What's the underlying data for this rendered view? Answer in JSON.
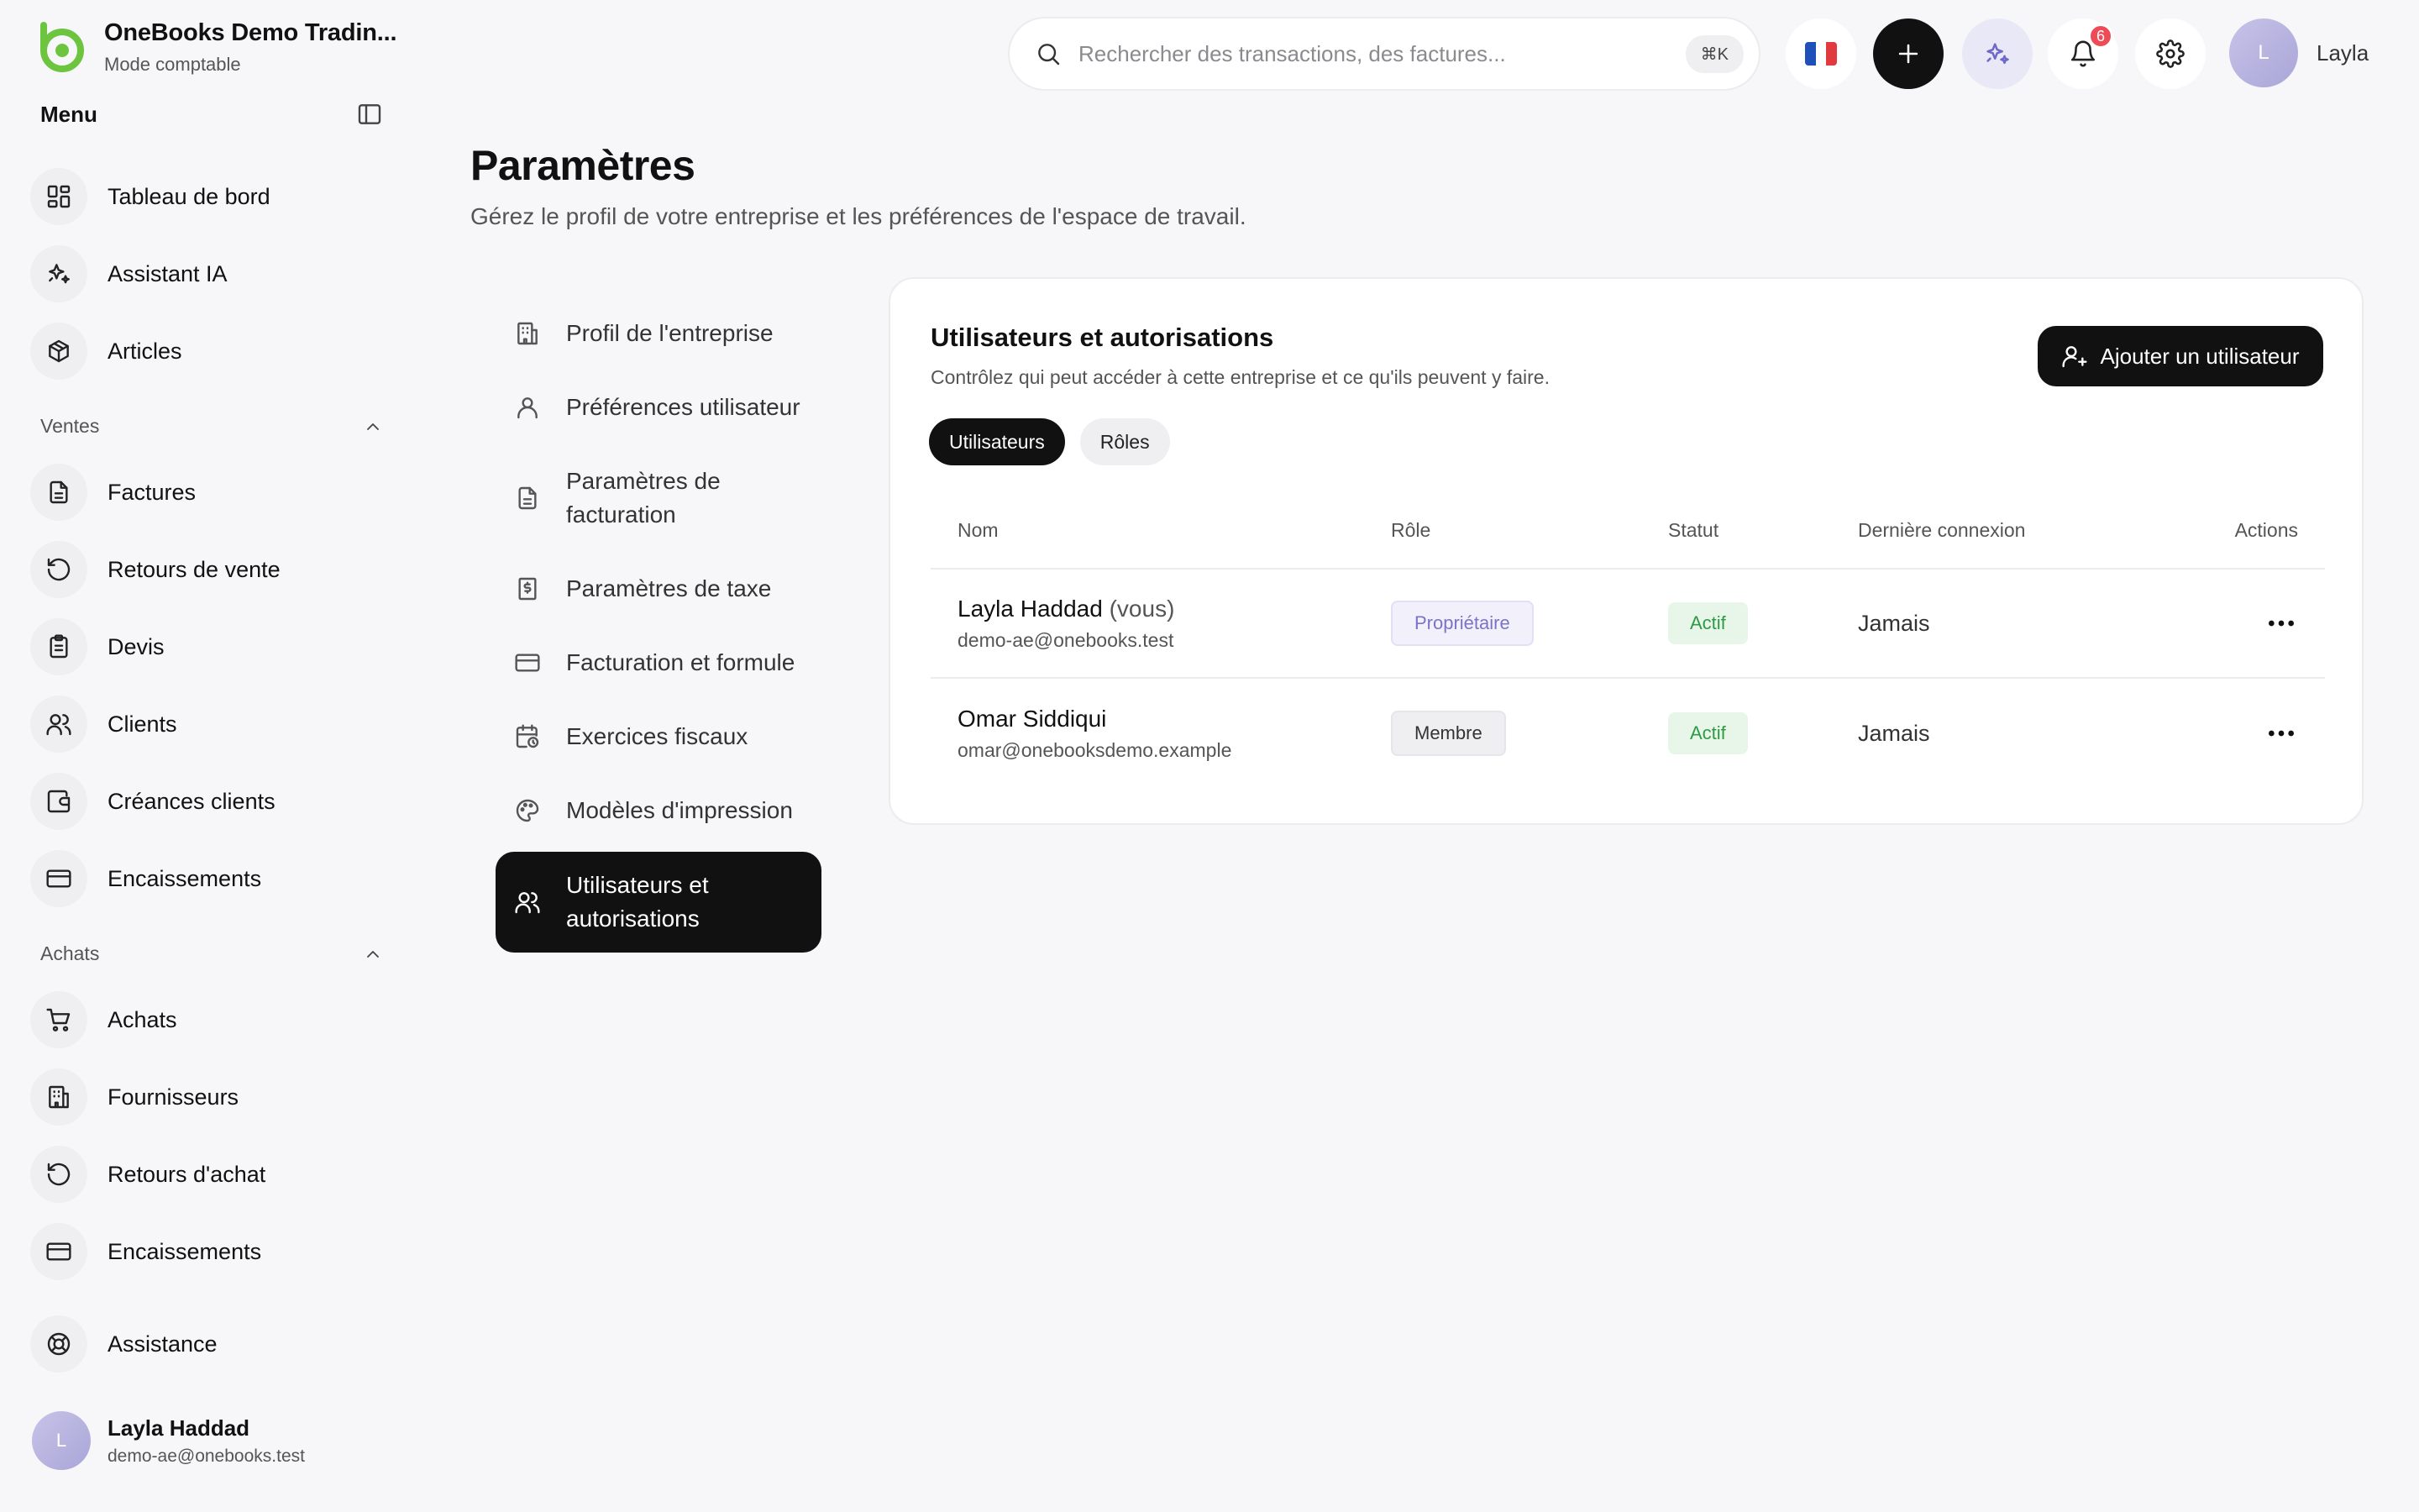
{
  "brand": {
    "name": "OneBooks Demo Tradin...",
    "mode": "Mode comptable",
    "accent_color": "#6cc43f"
  },
  "sidebar": {
    "menu_title": "Menu",
    "main_items": [
      {
        "label": "Tableau de bord",
        "icon": "dashboard-icon"
      },
      {
        "label": "Assistant IA",
        "icon": "sparkles-icon"
      },
      {
        "label": "Articles",
        "icon": "box-icon"
      }
    ],
    "sales": {
      "title": "Ventes",
      "items": [
        {
          "label": "Factures",
          "icon": "file-text-icon"
        },
        {
          "label": "Retours de vente",
          "icon": "rotate-ccw-icon"
        },
        {
          "label": "Devis",
          "icon": "clipboard-icon"
        },
        {
          "label": "Clients",
          "icon": "users-icon"
        },
        {
          "label": "Créances clients",
          "icon": "wallet-icon"
        },
        {
          "label": "Encaissements",
          "icon": "credit-card-icon"
        }
      ]
    },
    "purchases": {
      "title": "Achats",
      "items": [
        {
          "label": "Achats",
          "icon": "cart-icon"
        },
        {
          "label": "Fournisseurs",
          "icon": "building-icon"
        },
        {
          "label": "Retours d'achat",
          "icon": "rotate-ccw-icon"
        },
        {
          "label": "Encaissements",
          "icon": "credit-card-icon"
        }
      ]
    },
    "support": {
      "label": "Assistance",
      "icon": "lifebuoy-icon"
    },
    "user": {
      "initial": "L",
      "name": "Layla Haddad",
      "email": "demo-ae@onebooks.test"
    }
  },
  "topbar": {
    "search_placeholder": "Rechercher des transactions, des factures...",
    "search_shortcut": "⌘K",
    "notification_count": "6",
    "profile_initial": "L",
    "profile_name": "Layla"
  },
  "page": {
    "title": "Paramètres",
    "subtitle": "Gérez le profil de votre entreprise et les préférences de l'espace de travail."
  },
  "settings_nav": [
    {
      "label": "Profil de l'entreprise",
      "icon": "building-icon"
    },
    {
      "label": "Préférences utilisateur",
      "icon": "user-icon"
    },
    {
      "label": "Paramètres de facturation",
      "icon": "file-text-icon"
    },
    {
      "label": "Paramètres de taxe",
      "icon": "receipt-tax-icon"
    },
    {
      "label": "Facturation et formule",
      "icon": "credit-card-icon"
    },
    {
      "label": "Exercices fiscaux",
      "icon": "calendar-clock-icon"
    },
    {
      "label": "Modèles d'impression",
      "icon": "palette-icon"
    },
    {
      "label": "Utilisateurs et autorisations",
      "icon": "users-icon",
      "active": true
    }
  ],
  "users_card": {
    "title": "Utilisateurs et autorisations",
    "subtitle": "Contrôlez qui peut accéder à cette entreprise et ce qu'ils peuvent y faire.",
    "add_button": "Ajouter un utilisateur",
    "tabs": [
      {
        "label": "Utilisateurs",
        "active": true
      },
      {
        "label": "Rôles",
        "active": false
      }
    ],
    "columns": [
      "Nom",
      "Rôle",
      "Statut",
      "Dernière connexion",
      "Actions"
    ],
    "rows": [
      {
        "name": "Layla Haddad",
        "suffix": "(vous)",
        "email": "demo-ae@onebooks.test",
        "role": "Propriétaire",
        "status": "Actif",
        "last_login": "Jamais"
      },
      {
        "name": "Omar Siddiqui",
        "suffix": "",
        "email": "omar@onebooksdemo.example",
        "role": "Membre",
        "status": "Actif",
        "last_login": "Jamais"
      }
    ]
  }
}
